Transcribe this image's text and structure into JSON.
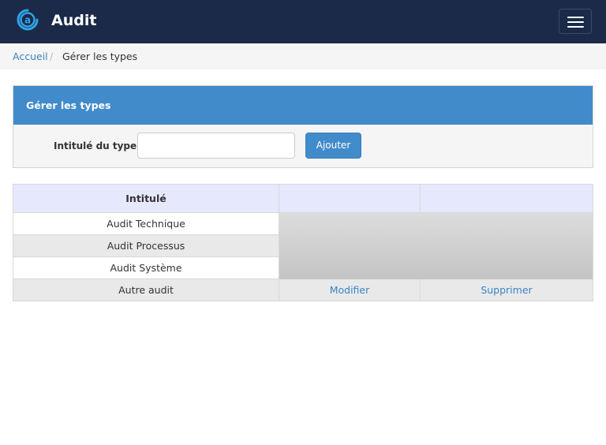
{
  "header": {
    "brand": "Audit",
    "logo_letter": "a",
    "logo_icon": "audit-logo-icon",
    "menu_icon": "hamburger-menu-icon"
  },
  "breadcrumb": {
    "home": "Accueil",
    "separator": "/",
    "current": "Gérer les types"
  },
  "panel": {
    "title": "Gérer les types",
    "field_label": "Intitulé du type",
    "field_value": "",
    "field_placeholder": "",
    "add_button": "Ajouter"
  },
  "table": {
    "headers": [
      "Intitulé",
      "",
      ""
    ],
    "rows": [
      {
        "label": "Audit Technique",
        "edit": "",
        "delete": ""
      },
      {
        "label": "Audit Processus",
        "edit": "",
        "delete": ""
      },
      {
        "label": "Audit Système",
        "edit": "",
        "delete": ""
      },
      {
        "label": "Autre audit",
        "edit": "Modifier",
        "delete": "Supprimer"
      }
    ]
  },
  "colors": {
    "navbar": "#1a2a48",
    "primary": "#428bca",
    "link": "#3a83c2",
    "table_header": "#e6e8fe"
  }
}
